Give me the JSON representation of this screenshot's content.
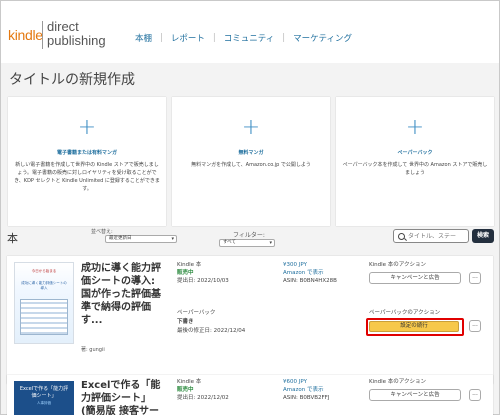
{
  "header": {
    "logo_kindle": "kindle",
    "logo_direct": "direct",
    "logo_publishing": "publishing",
    "nav": [
      "本棚",
      "レポート",
      "コミュニティ",
      "マーケティング"
    ]
  },
  "page_title": "タイトルの新規作成",
  "cards": [
    {
      "title": "電子書籍または有料マンガ",
      "desc": "新しい電子書籍を作成して世界中の Kindle ストアで販売しましょう。電子書籍の販売に対しロイヤリティを受け取ることができ、KDP セレクトと Kindle Unlimited に登録することができます。"
    },
    {
      "title": "無料マンガ",
      "desc": "無料マンガを作成して、Amazon.co.jp で公開しよう"
    },
    {
      "title": "ペーパーバック",
      "desc": "ペーパーバック本を作成して 世界中の Amazon ストアで販売しましょう"
    }
  ],
  "books_section": {
    "title": "本",
    "sort_label": "並べ替え:",
    "sort_value": "最近更新日",
    "filter_label": "フィルター:",
    "filter_value": "すべて",
    "search_placeholder": "タイトル、ステー",
    "search_button": "検索"
  },
  "books": [
    {
      "cover_text_top": "今日から始まる",
      "cover_text_main": "成功に導く能力評価シートの導入",
      "title": "成功に導く能力評価シートの導入: 国が作った評価基準で納得の評価 す...",
      "author": "著: gungii",
      "kindle": {
        "format": "Kindle 本",
        "status": "販売中",
        "date": "提出日: 2022/10/03",
        "price": "¥300 JPY",
        "amazon_link": "Amazon で表示",
        "asin": "ASIN: B0BN4HX28B",
        "action_title": "Kindle 本のアクション",
        "action_button": "キャンペーンと広告"
      },
      "paperback": {
        "format": "ペーパーバック",
        "status": "下書き",
        "date": "最後の修正日: 2022/12/04",
        "action_title": "ペーパーバックのアクション",
        "action_button": "設定の続行"
      }
    },
    {
      "cover_text_main": "Excelで作る「能力評価シート」",
      "cover_text_sub": "人事評価",
      "title": "Excelで作る「能力評価シート」(簡易版 接客サービ",
      "kindle": {
        "format": "Kindle 本",
        "status": "販売中",
        "date": "提出日: 2022/12/02",
        "price": "¥600 JPY",
        "amazon_link": "Amazon で表示",
        "asin": "ASIN: B0BVB2FFJ",
        "action_title": "Kindle 本のアクション",
        "action_button": "キャンペーンと広告"
      }
    }
  ],
  "more_label": "...",
  "colors": {
    "accent_link": "#1f6f9e",
    "brand_orange": "#e47911",
    "highlight": "#e00000",
    "primary_button": "#f7c84a",
    "search_button": "#232f3e"
  }
}
